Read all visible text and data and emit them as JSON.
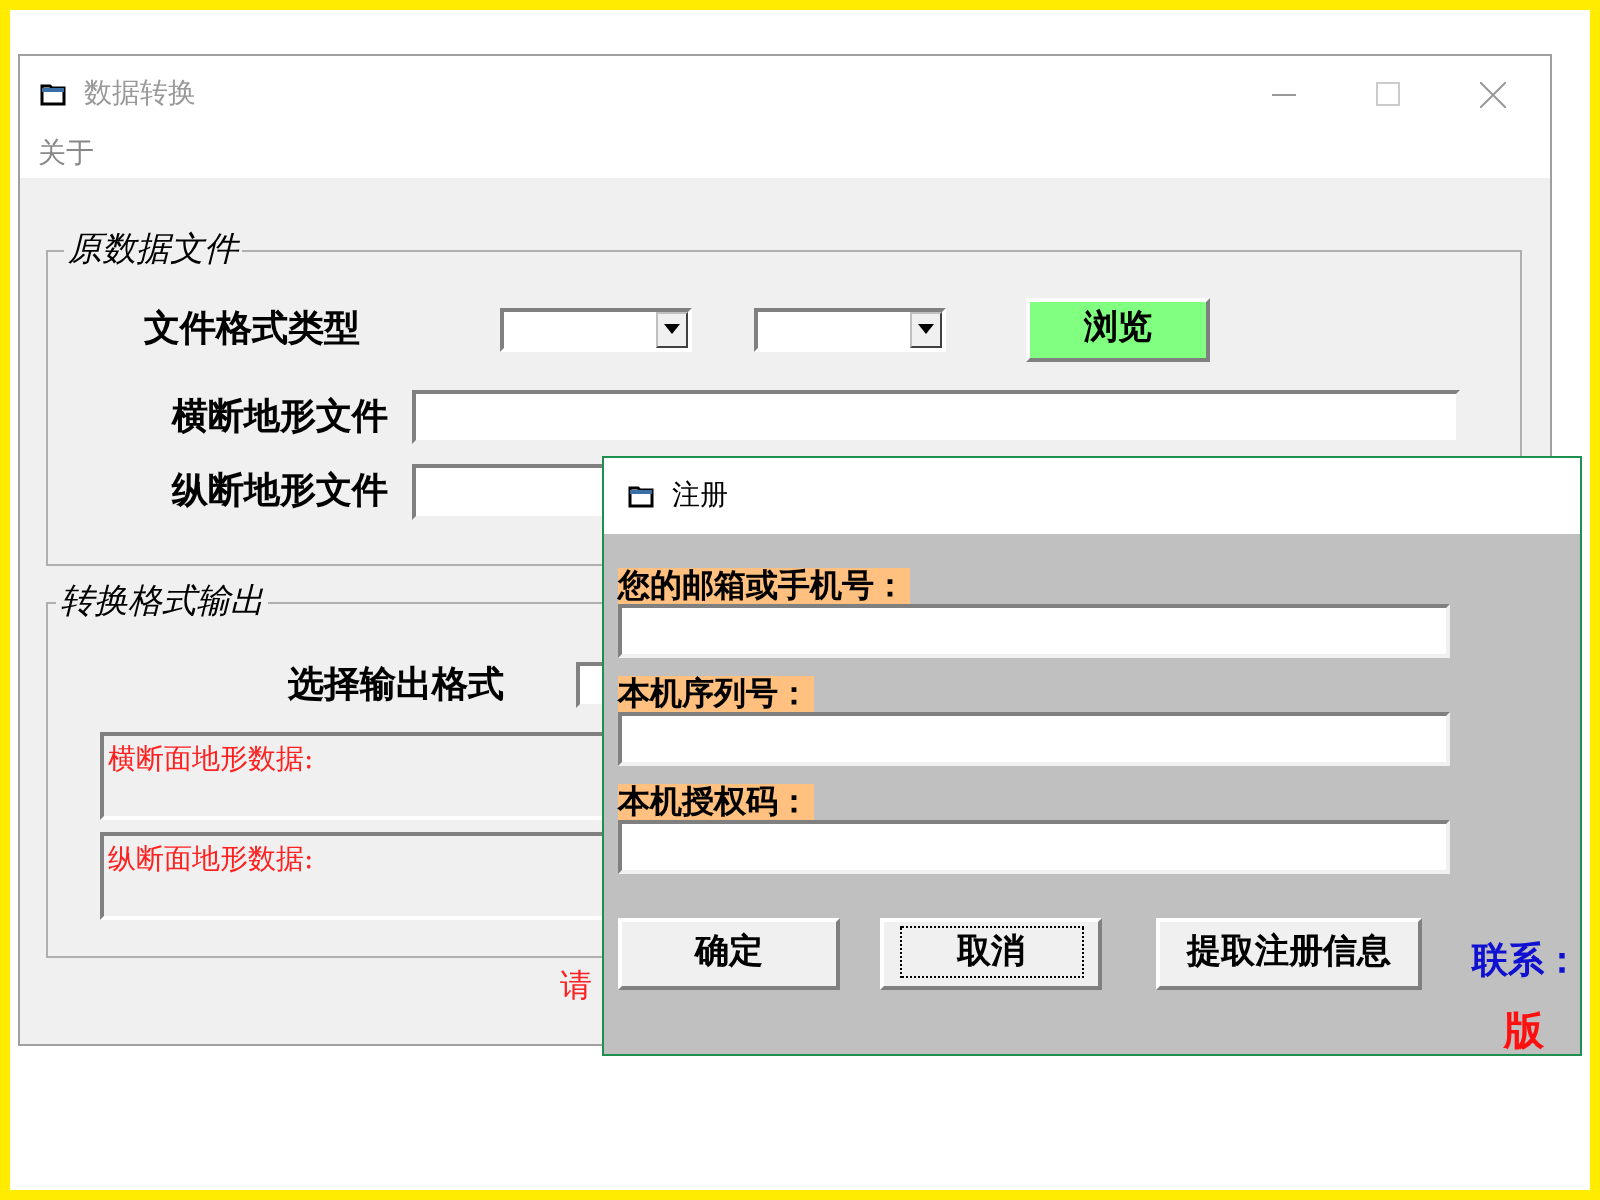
{
  "main_window": {
    "title": "数据转换",
    "menu": [
      "关于"
    ],
    "source_group": {
      "title": "原数据文件",
      "format_label": "文件格式类型",
      "browse_button": "浏览",
      "cross_label": "横断地形文件",
      "long_label": "纵断地形文件"
    },
    "output_group": {
      "title": "转换格式输出",
      "format_label": "选择输出格式",
      "data_boxes": [
        "横断面地形数据:",
        "纵断面地形数据:"
      ]
    },
    "notice": "请"
  },
  "dialog": {
    "title": "注册",
    "fields": [
      {
        "label": "您的邮箱或手机号："
      },
      {
        "label": "本机序列号："
      },
      {
        "label": "本机授权码："
      }
    ],
    "buttons": [
      {
        "label": "确定",
        "focused": false
      },
      {
        "label": "取消",
        "focused": true
      },
      {
        "label": "提取注册信息",
        "focused": false
      }
    ],
    "contact": "联系：",
    "copyright": "版"
  }
}
